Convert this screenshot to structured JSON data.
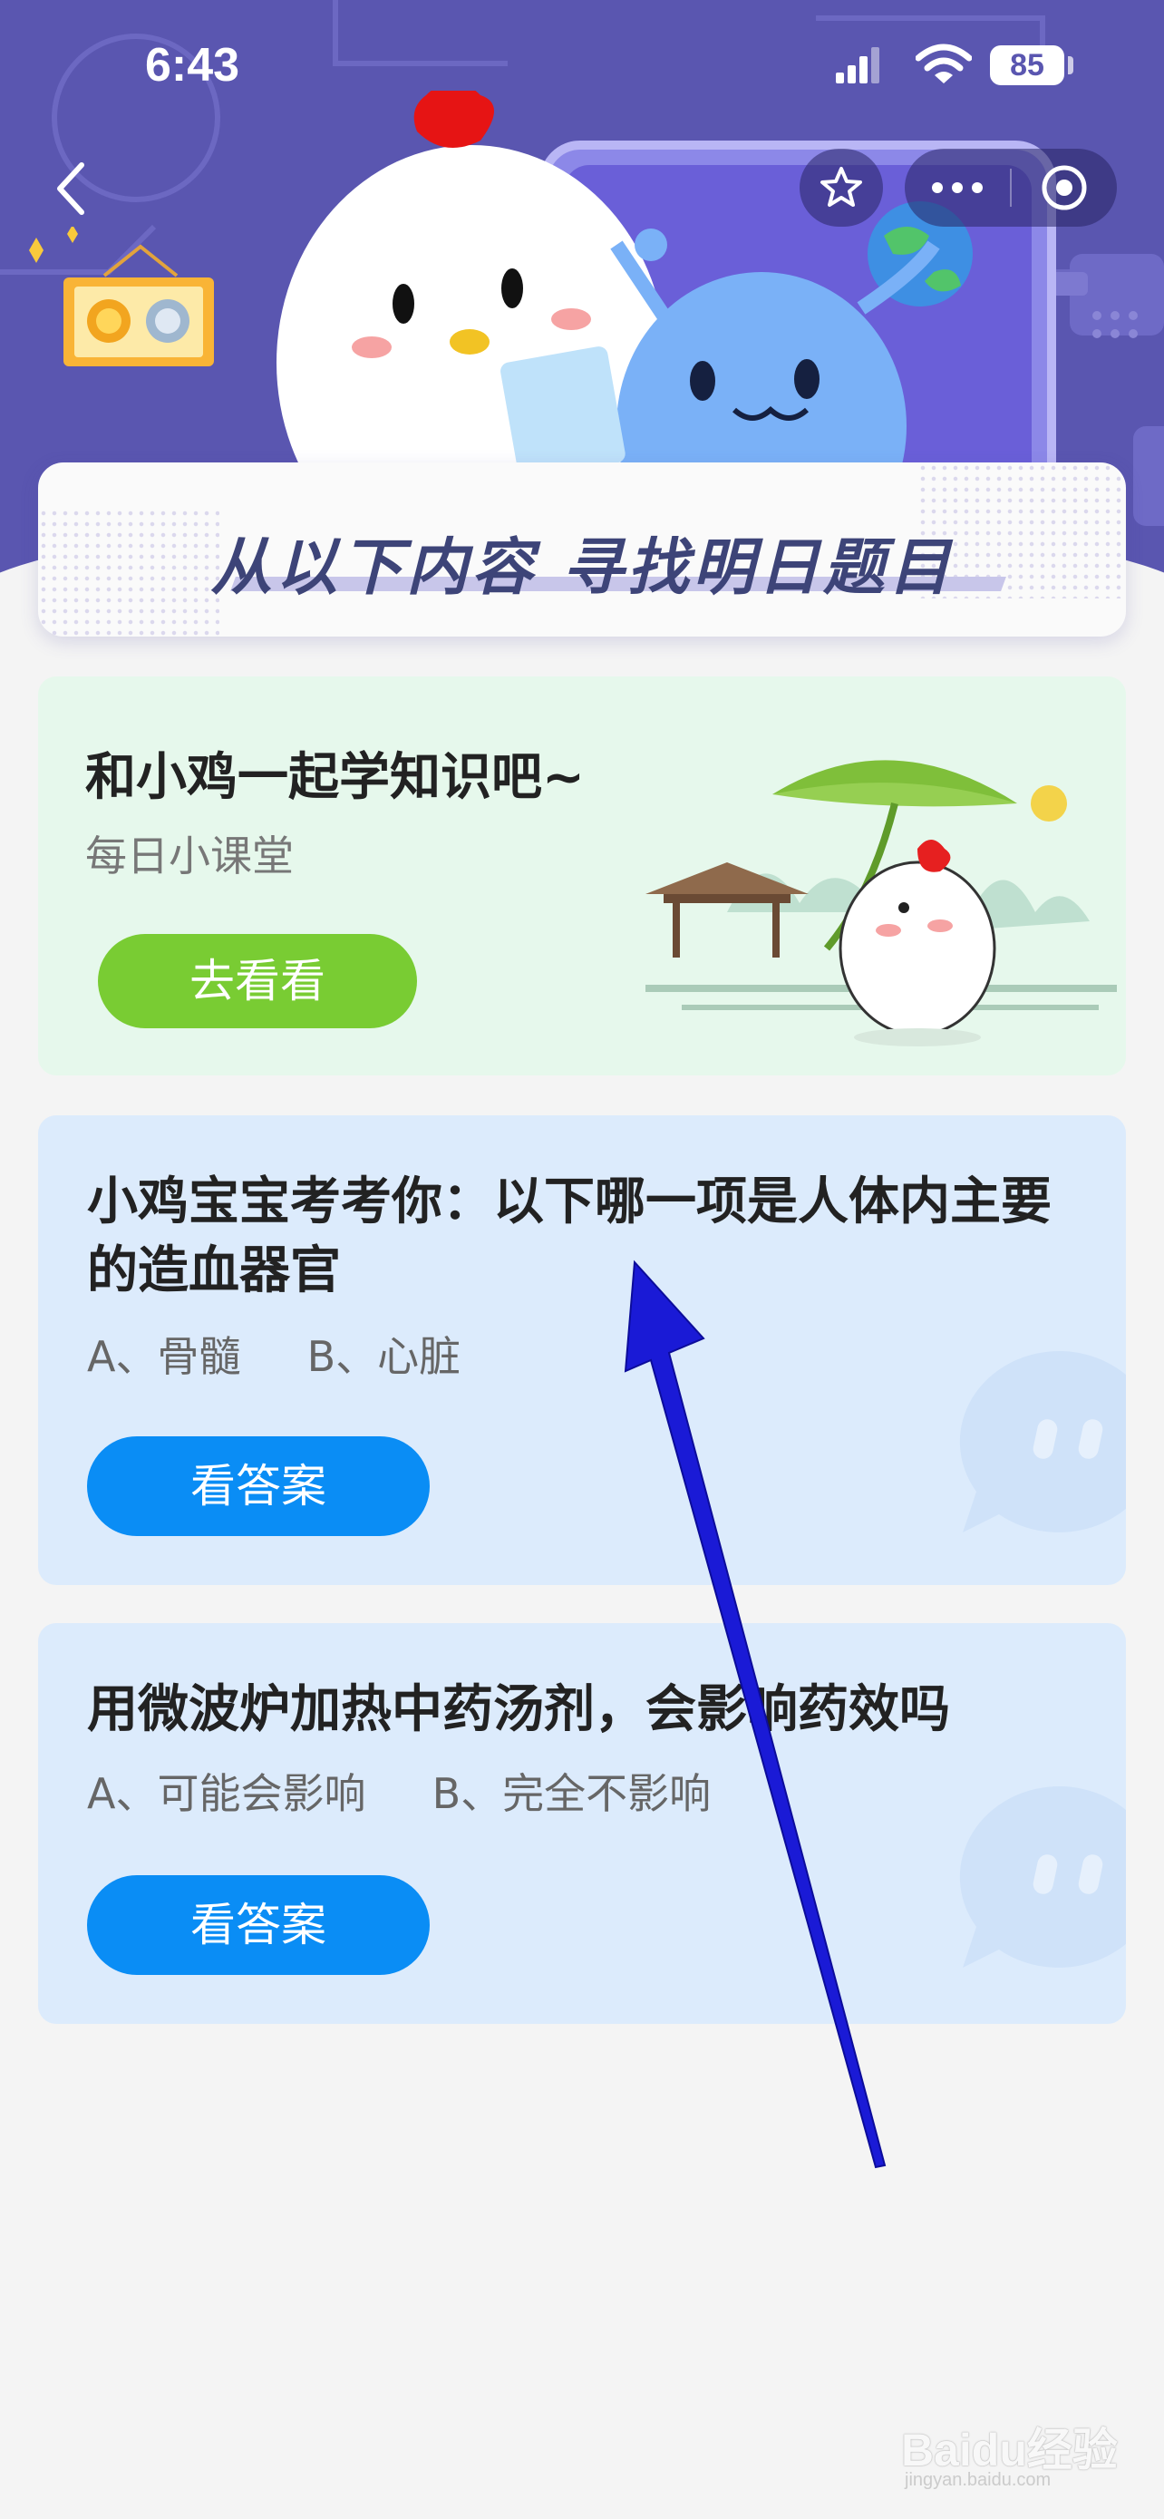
{
  "status_bar": {
    "time": "6:43",
    "battery": "85",
    "icons": [
      "signal-icon",
      "wifi-icon",
      "battery-icon"
    ]
  },
  "nav": {
    "icons": [
      "back-chevron-icon",
      "star-icon",
      "more-dots-icon",
      "target-circle-icon"
    ]
  },
  "banner": {
    "title": "从以下内容  寻找明日题目"
  },
  "lesson_card": {
    "title": "和小鸡一起学知识吧~",
    "subtitle": "每日小课堂",
    "button_label": "去看看"
  },
  "quiz_cards": [
    {
      "question": "小鸡宝宝考考你：以下哪一项是人体内主要的造血器官",
      "options": "A、骨髓     B、心脏",
      "button_label": "看答案"
    },
    {
      "question": "用微波炉加热中药汤剂，会影响药效吗",
      "options": "A、可能会影响     B、完全不影响",
      "button_label": "看答案"
    }
  ],
  "watermark": {
    "text": "Baidu经验",
    "sub": "jingyan.baidu.com"
  },
  "colors": {
    "header_purple": "#5a56b0",
    "lesson_bg": "#e6f8ec",
    "quiz_bg": "#dcebfc",
    "green_button": "#79cc33",
    "blue_button": "#0a8df5",
    "arrow": "#1a1ad6"
  }
}
